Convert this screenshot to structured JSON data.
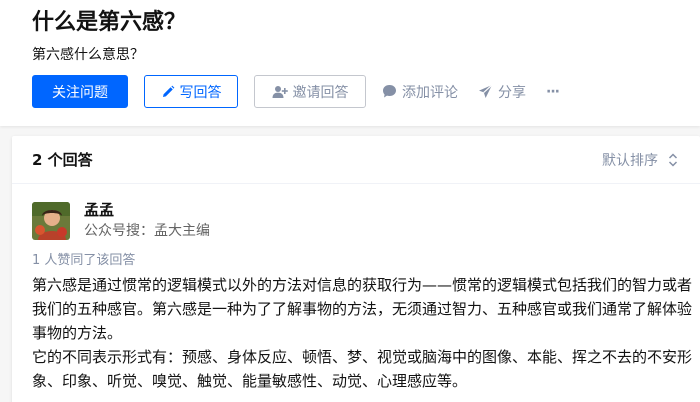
{
  "question": {
    "title": "什么是第六感？",
    "description": "第六感什么意思？"
  },
  "actions": {
    "follow": "关注问题",
    "write": "写回答",
    "invite": "邀请回答",
    "comment": "添加评论",
    "share": "分享",
    "more": "···"
  },
  "answers": {
    "count_label": "2 个回答",
    "sort_label": "默认排序"
  },
  "answer": {
    "author_name": "孟孟",
    "author_bio": "公众号搜：孟大主编",
    "votes": "1 人赞同了该回答",
    "paragraphs": [
      "第六感是通过惯常的逻辑模式以外的方法对信息的获取行为——惯常的逻辑模式包括我们的智力或者我们的五种感官。第六感是一种为了了解事物的方法，无须通过智力、五种感官或我们通常了解体验事物的方法。",
      "它的不同表示形式有：预感、身体反应、顿悟、梦、视觉或脑海中的图像、本能、挥之不去的不安形象、印象、听觉、嗅觉、触觉、能量敏感性、动觉、心理感应等。"
    ]
  },
  "colors": {
    "brand_blue": "#0066ff",
    "meta_gray": "#8590a6"
  }
}
